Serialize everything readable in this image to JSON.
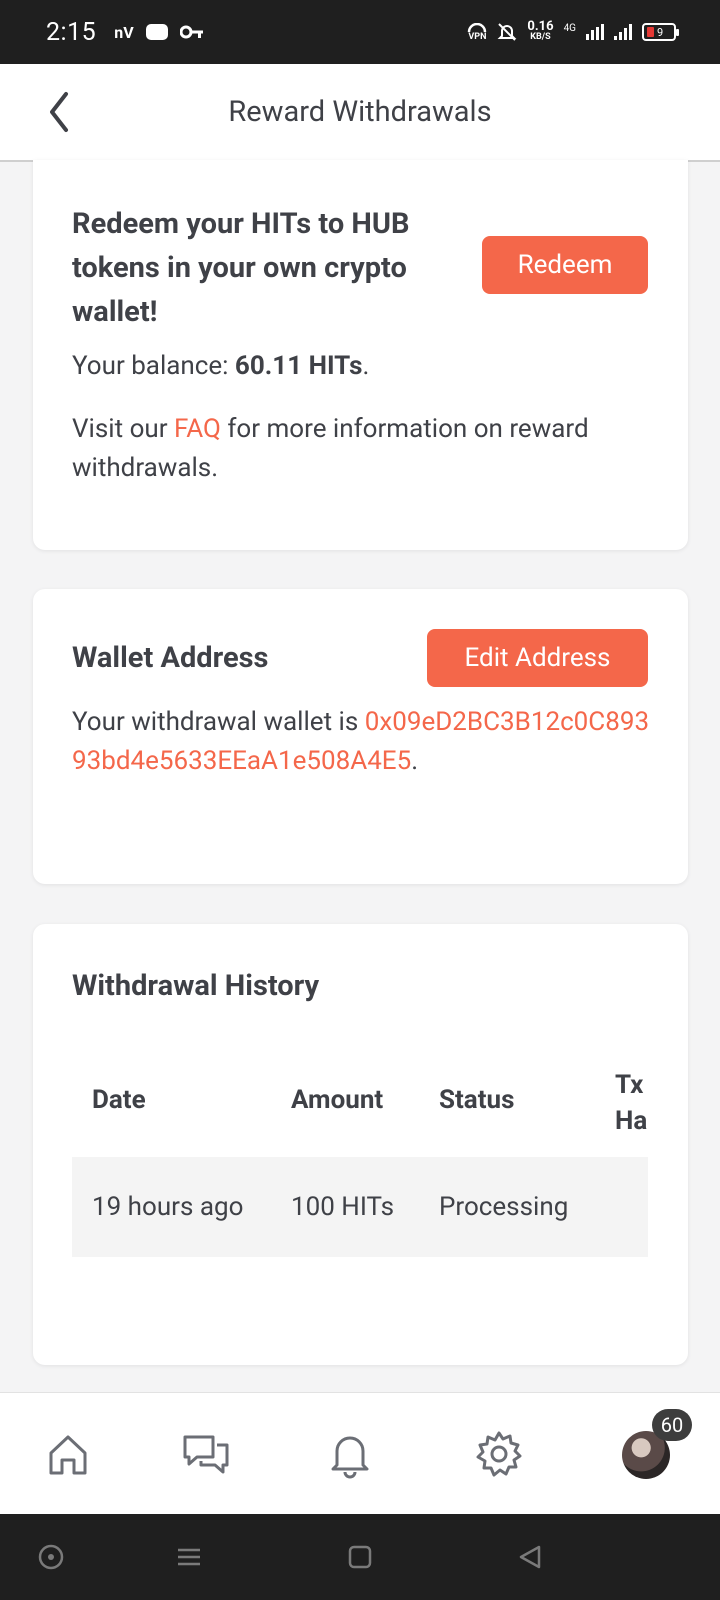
{
  "status_bar": {
    "time": "2:15",
    "carrier_icon_text": "nV",
    "vpn_label": "VPN",
    "net_speed_value": "0.16",
    "net_speed_unit": "KB/S",
    "network_type": "4G",
    "battery_level": "9",
    "battery_color": "#e53935"
  },
  "header": {
    "title": "Reward Withdrawals",
    "back_icon": "chevron-left-icon"
  },
  "redeem_card": {
    "heading": "Redeem your HITs to HUB tokens in your own crypto wallet!",
    "redeem_button": "Redeem",
    "balance_prefix": "Your balance: ",
    "balance_value": "60.11 HITs",
    "balance_suffix": ".",
    "faq_prefix": "Visit our ",
    "faq_link": "FAQ",
    "faq_suffix": " for more information on reward withdrawals."
  },
  "wallet_card": {
    "title": "Wallet Address",
    "edit_button": "Edit Address",
    "text_prefix": "Your withdrawal wallet is ",
    "address": "0x09eD2BC3B12c0C89393bd4e5633EEaA1e508A4E5",
    "text_suffix": "."
  },
  "history_card": {
    "title": "Withdrawal History",
    "columns": [
      "Date",
      "Amount",
      "Status",
      "Tx Hash"
    ],
    "rows": [
      {
        "date": "19 hours ago",
        "amount": "100 HITs",
        "status": "Processing",
        "tx_hash": ""
      }
    ]
  },
  "bottom_nav": {
    "items": [
      "home-icon",
      "chat-icon",
      "bell-icon",
      "gear-icon",
      "avatar"
    ],
    "avatar_badge": "60"
  },
  "colors": {
    "accent": "#f4674a",
    "text": "#3f4147",
    "background": "#f4f4f5"
  }
}
